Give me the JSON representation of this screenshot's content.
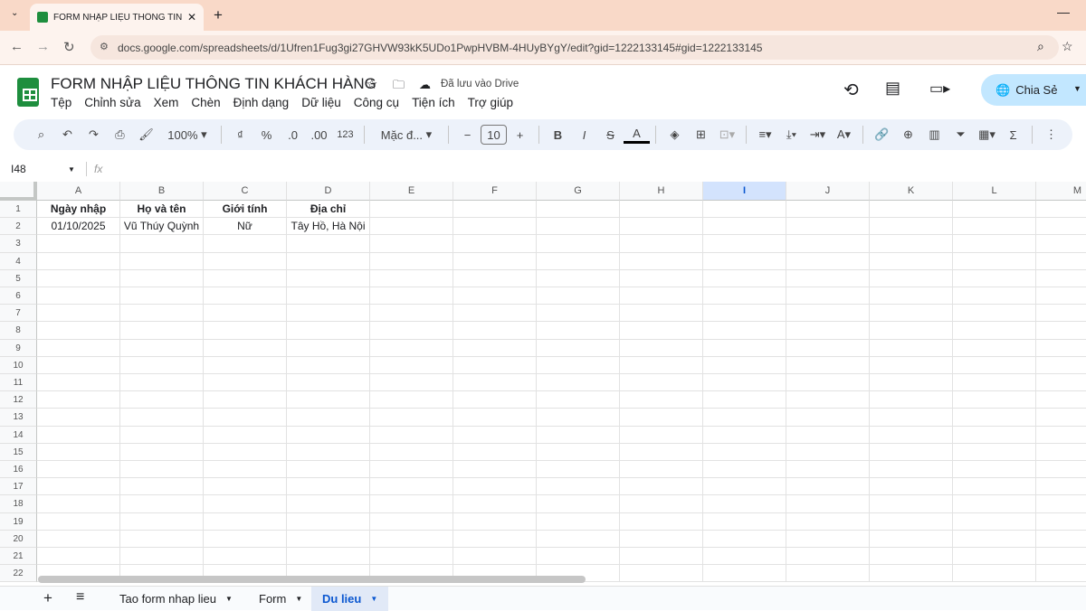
{
  "browser": {
    "tab_title": "FORM NHẬP LIỆU THÔNG TIN K",
    "url": "docs.google.com/spreadsheets/d/1Ufren1Fug3gi27GHVW93kK5UDo1PwpHVBM-4HUyBYgY/edit?gid=1222133145#gid=1222133145"
  },
  "doc": {
    "title": "FORM NHẬP LIỆU THÔNG TIN KHÁCH HÀNG",
    "save_status": "Đã lưu vào Drive",
    "share_label": "Chia Sẻ"
  },
  "menu": [
    "Tệp",
    "Chỉnh sửa",
    "Xem",
    "Chèn",
    "Định dạng",
    "Dữ liệu",
    "Công cụ",
    "Tiện ích",
    "Trợ giúp"
  ],
  "toolbar": {
    "zoom": "100%",
    "currency": "₫",
    "percent": "%",
    "dec_dec": ".0",
    "inc_dec": ".00",
    "number_format": "123",
    "font": "Mặc đ...",
    "font_size": "10"
  },
  "formula_bar": {
    "cell_ref": "I48",
    "fx": "fx",
    "value": ""
  },
  "columns": [
    "A",
    "B",
    "C",
    "D",
    "E",
    "F",
    "G",
    "H",
    "I",
    "J",
    "K",
    "L",
    "M"
  ],
  "selected_column": "I",
  "rows": [
    [
      "Ngày nhập",
      "Họ và tên",
      "Giới tính",
      "Địa chỉ"
    ],
    [
      "01/10/2025",
      "Vũ Thúy Quỳnh",
      "Nữ",
      "Tây Hồ, Hà Nội"
    ]
  ],
  "row_count": 22,
  "sheets": [
    {
      "name": "Tao form nhap lieu",
      "active": false
    },
    {
      "name": "Form",
      "active": false
    },
    {
      "name": "Du lieu",
      "active": true
    }
  ]
}
